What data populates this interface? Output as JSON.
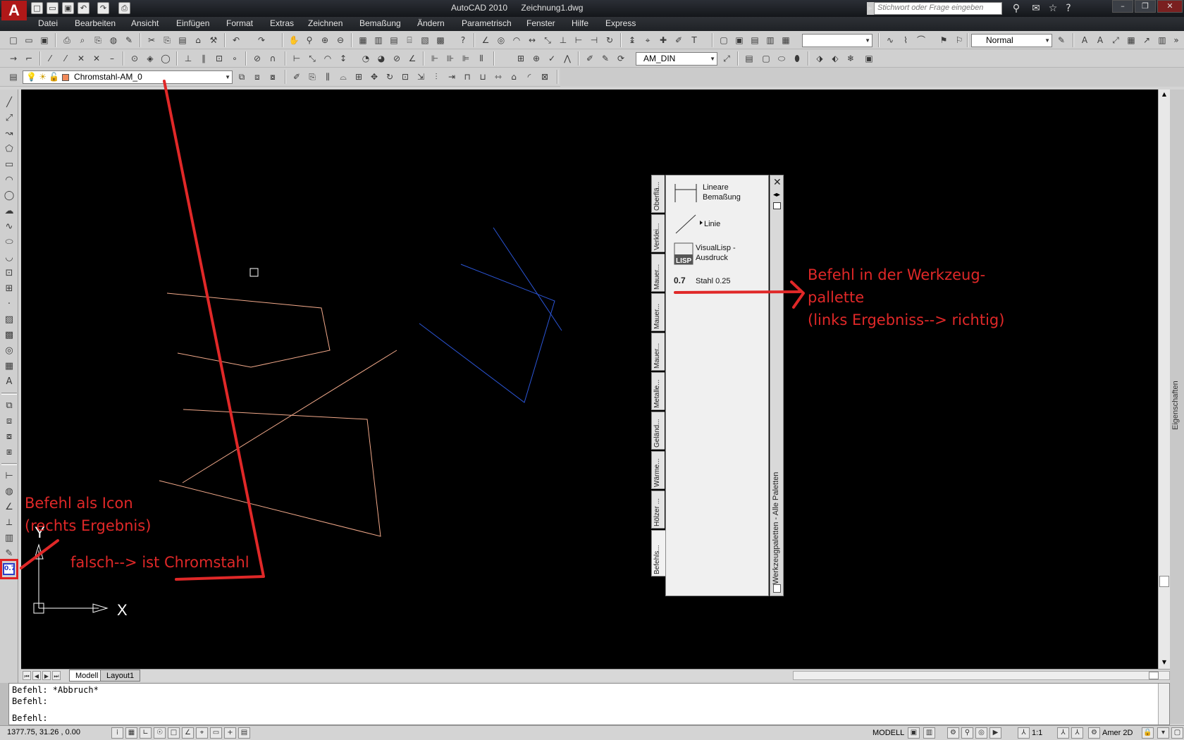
{
  "title": {
    "app": "AutoCAD 2010",
    "file": "Zeichnung1.dwg",
    "search_placeholder": "Stichwort oder Frage eingeben"
  },
  "menu": [
    "Datei",
    "Bearbeiten",
    "Ansicht",
    "Einfügen",
    "Format",
    "Extras",
    "Zeichnen",
    "Bemaßung",
    "Ändern",
    "Parametrisch",
    "Fenster",
    "Hilfe",
    "Express"
  ],
  "toolbars": {
    "plotstyle_value": "Normal",
    "dimstyle_value": "AM_DIN",
    "layer_value": "Chromstahl-AM_0",
    "layer_color": "#f28a5a"
  },
  "layout_tabs": [
    "Modell",
    "Layout1"
  ],
  "command_lines": [
    "Befehl: *Abbruch*",
    "Befehl:",
    "Befehl:"
  ],
  "status": {
    "coords": "1377.75, 31.26  , 0.00",
    "model_label": "MODELL",
    "scale": "1:1",
    "workspace": "Amer 2D"
  },
  "ucs": {
    "y_label": "Y",
    "x_label": "X"
  },
  "palette": {
    "title": "Werkzeugpaletten - Alle Paletten",
    "tabs": [
      "Oberflä...",
      "Verklei...",
      "Mauer...",
      "Mauer...",
      "Mauer...",
      "Metalle...",
      "Geländ...",
      "Wärme...",
      "Hölzer ...",
      "Befehls..."
    ],
    "items": [
      {
        "label": "Lineare Bemaßung",
        "icon": "linear-dimension-icon"
      },
      {
        "label": "Linie",
        "icon": "line-icon"
      },
      {
        "label": "VisualLisp -Ausdruck",
        "icon": "lisp-icon"
      },
      {
        "label": "Stahl 0.25",
        "icon": "lineweight-icon"
      }
    ]
  },
  "side_tab": "Eigenschaften",
  "annotations": {
    "palette_note": [
      "Befehl in der Werkzeug-",
      "pallette",
      "(links Ergebniss--> richtig)"
    ],
    "icon_note": [
      "Befehl als Icon",
      "(rechts Ergebnis)"
    ],
    "wrong_note": "falsch--> ist Chromstahl",
    "color": "#e02828"
  },
  "drawing_colors": {
    "steel": "#f2a98a",
    "blue": "#2b55d6",
    "background": "#000000"
  }
}
